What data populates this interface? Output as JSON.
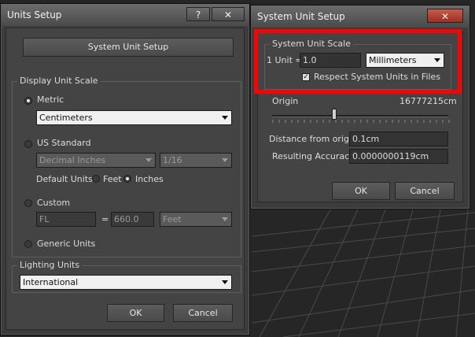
{
  "units_setup": {
    "title": "Units Setup",
    "help_label": "?",
    "close_label": "✕",
    "system_unit_setup_button": "System Unit Setup",
    "display_unit_scale_group": "Display Unit Scale",
    "metric_label": "Metric",
    "metric_selected": "Centimeters",
    "us_standard_label": "US Standard",
    "us_standard_selected": "Decimal Inches",
    "us_fraction_selected": "1/16",
    "default_units_label": "Default Units:",
    "feet_label": "Feet",
    "inches_label": "Inches",
    "custom_label": "Custom",
    "custom_name": "FL",
    "equals_label": "=",
    "custom_value": "660.0",
    "custom_unit_selected": "Feet",
    "generic_units_label": "Generic Units",
    "lighting_units_group": "Lighting Units",
    "lighting_selected": "International",
    "ok_label": "OK",
    "cancel_label": "Cancel"
  },
  "system_unit_setup": {
    "title": "System Unit Setup",
    "close_label": "✕",
    "scale_group": "System Unit Scale",
    "one_unit_label": "1 Unit =",
    "unit_value": "1.0",
    "unit_selected": "Millimeters",
    "respect_label": "Respect System Units in Files",
    "origin_label": "Origin",
    "origin_value": "16777215cm",
    "distance_label": "Distance from origin:",
    "distance_value": "0.1cm",
    "accuracy_label": "Resulting Accuracy:",
    "accuracy_value": "0.0000000119cm",
    "ok_label": "OK",
    "cancel_label": "Cancel"
  },
  "colors": {
    "highlight": "#ff0000",
    "window_bg": "#444444",
    "viewport_bg": "#262626"
  }
}
